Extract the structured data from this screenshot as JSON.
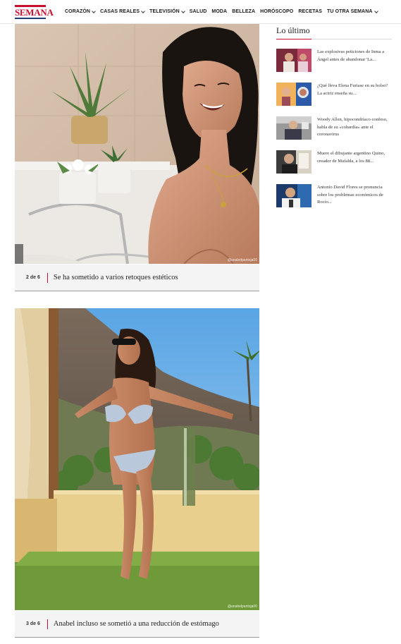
{
  "nav": {
    "logo": "SEMANA",
    "items": [
      {
        "label": "CORAZÓN",
        "dropdown": true
      },
      {
        "label": "CASAS REALES",
        "dropdown": true
      },
      {
        "label": "TELEVISIÓN",
        "dropdown": true
      },
      {
        "label": "SALUD",
        "dropdown": false
      },
      {
        "label": "MODA",
        "dropdown": false
      },
      {
        "label": "BELLEZA",
        "dropdown": false
      },
      {
        "label": "HORÓSCOPO",
        "dropdown": false
      },
      {
        "label": "RECETAS",
        "dropdown": false
      },
      {
        "label": "TU OTRA SEMANA",
        "dropdown": true
      }
    ]
  },
  "gallery": {
    "slides": [
      {
        "credit": "@anabelpantoja00",
        "number": "2 de 6",
        "caption": "Se ha sometido a varios retoques estéticos"
      },
      {
        "credit": "@anabelpantoja00",
        "number": "3 de 6",
        "caption": "Anabel incluso se sometió a una reducción de estómago"
      }
    ]
  },
  "sidebar": {
    "title": "Lo último",
    "items": [
      {
        "text": "Las explosivas peticiones de Inma a Ángel antes de abandonar 'La..."
      },
      {
        "text": "¿Qué lleva Elena Furiase en su bolso? La actriz enseña su..."
      },
      {
        "text": "Woody Allen, hipocondríaco confeso, habla de su «cobardía» ante el coronavirus"
      },
      {
        "text": "Muere el dibujante argentino Quino, creador de Mafalda, a los 88..."
      },
      {
        "text": "Antonio David Flores se pronuncia sobre los problemas económicos de Rocío..."
      }
    ]
  },
  "colors": {
    "brand": "#c8102e",
    "navy": "#1f3b73"
  }
}
